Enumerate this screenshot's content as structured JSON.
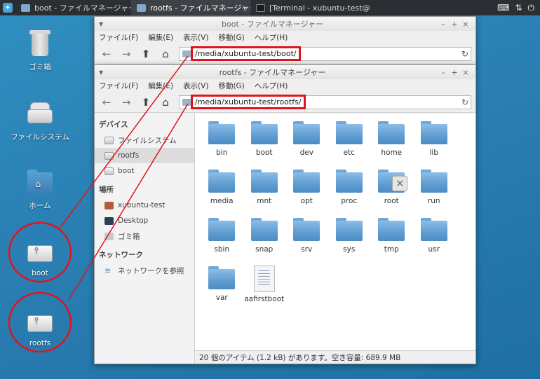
{
  "panel": {
    "tasks": [
      {
        "label": "boot - ファイルマネージャー",
        "active": false
      },
      {
        "label": "rootfs - ファイルマネージャー",
        "active": true
      },
      {
        "label": "[Terminal - xubuntu-test@ub...",
        "active": false
      }
    ],
    "tray_icons": [
      "keyboard-icon",
      "network-icon",
      "power-icon"
    ]
  },
  "desktop": {
    "icons": [
      {
        "label": "ゴミ箱",
        "icon": "trash-icon"
      },
      {
        "label": "ファイルシステム",
        "icon": "harddisk-icon"
      },
      {
        "label": "ホーム",
        "icon": "home-folder-icon"
      },
      {
        "label": "boot",
        "icon": "usb-drive-icon"
      },
      {
        "label": "rootfs",
        "icon": "usb-drive-icon"
      }
    ]
  },
  "menus": [
    "ファイル(F)",
    "編集(E)",
    "表示(V)",
    "移動(G)",
    "ヘルプ(H)"
  ],
  "boot_window": {
    "title": "boot - ファイルマネージャー",
    "path": "/media/xubuntu-test/boot/"
  },
  "rootfs_window": {
    "title": "rootfs - ファイルマネージャー",
    "path": "/media/xubuntu-test/rootfs/",
    "sidebar": {
      "devices_header": "デバイス",
      "devices": [
        "ファイルシステム",
        "rootfs",
        "boot"
      ],
      "places_header": "場所",
      "places": [
        "xubuntu-test",
        "Desktop",
        "ゴミ箱"
      ],
      "network_header": "ネットワーク",
      "network": [
        "ネットワークを参照"
      ]
    },
    "files": [
      "bin",
      "boot",
      "dev",
      "etc",
      "home",
      "lib",
      "media",
      "mnt",
      "opt",
      "proc",
      "root",
      "run",
      "sbin",
      "snap",
      "srv",
      "sys",
      "tmp",
      "usr",
      "var",
      "aafirstboot"
    ],
    "status": "20 個のアイテム (1.2 kB) があります。空き容量: 689.9 MB"
  },
  "colors": {
    "annotation": "#e0141e",
    "folder": "#5f9cd2"
  }
}
